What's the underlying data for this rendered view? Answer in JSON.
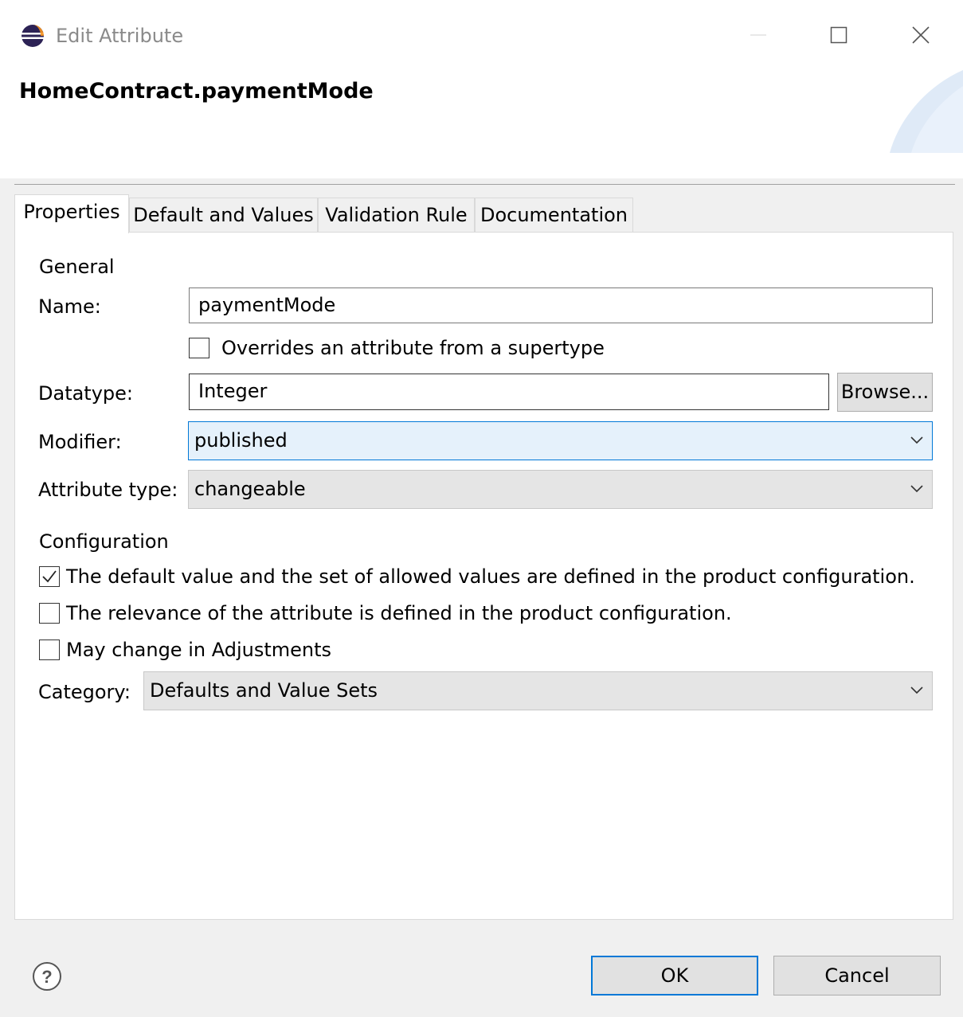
{
  "window": {
    "title": "Edit Attribute"
  },
  "banner": {
    "title": "HomeContract.paymentMode"
  },
  "tabs": [
    {
      "label": "Properties",
      "active": true
    },
    {
      "label": "Default and Values",
      "active": false
    },
    {
      "label": "Validation Rule",
      "active": false
    },
    {
      "label": "Documentation",
      "active": false
    }
  ],
  "general": {
    "heading": "General",
    "name_label": "Name:",
    "name_value": "paymentMode",
    "overrides_label": "Overrides an attribute from a supertype",
    "overrides_checked": false,
    "datatype_label": "Datatype:",
    "datatype_value": "Integer",
    "browse_label": "Browse...",
    "modifier_label": "Modifier:",
    "modifier_value": "published",
    "attribute_type_label": "Attribute type:",
    "attribute_type_value": "changeable"
  },
  "configuration": {
    "heading": "Configuration",
    "options": [
      {
        "label": "The default value and the set of allowed values are defined in the product configuration.",
        "checked": true
      },
      {
        "label": "The relevance of the attribute is defined in the product configuration.",
        "checked": false
      },
      {
        "label": "May change in Adjustments",
        "checked": false
      }
    ],
    "category_label": "Category:",
    "category_value": "Defaults and Value Sets"
  },
  "footer": {
    "ok_label": "OK",
    "cancel_label": "Cancel"
  },
  "icons": {
    "app": "eclipse-icon",
    "help": "help-icon",
    "minimize": "minimize-icon",
    "maximize": "maximize-icon",
    "close": "close-icon",
    "dropdown": "chevron-down-icon",
    "check": "checkmark-icon"
  },
  "colors": {
    "accent": "#0078d7",
    "selected_combo_bg": "#e5f1fb"
  }
}
